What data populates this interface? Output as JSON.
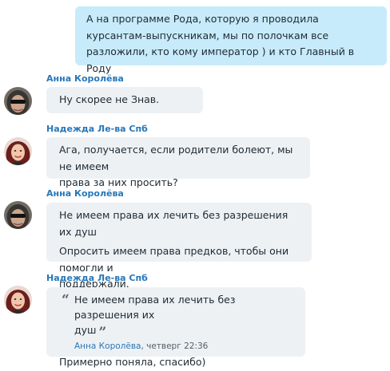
{
  "outgoing": {
    "lines": [
      "А на программе Рода, которую я проводила",
      "курсантам-выпускникам, мы по полочкам все",
      "разложили, кто кому император ) и кто Главный в Роду"
    ]
  },
  "messages": [
    {
      "sender": "Анна Королёва",
      "text_lines": [
        "Ну скорее не Знав."
      ]
    },
    {
      "sender": "Надежда Ле-ва Спб",
      "text_lines": [
        "Ага, получается, если родители болеют, мы не имеем",
        "права за них просить?"
      ]
    },
    {
      "sender": "Анна Королёва",
      "text_lines": [
        "Не имеем права их лечить без разрешения их душ"
      ],
      "text2_lines": [
        "Опросить имеем права предков, чтобы они помогли и",
        "поддержали."
      ]
    },
    {
      "sender": "Надежда Ле-ва Спб",
      "quote": {
        "lines": [
          "Не имеем права их лечить без разрешения их",
          "душ"
        ],
        "author": "Анна Королёва",
        "timestamp": ", четверг 22:36"
      },
      "text_lines": [
        "Примерно поняла, спасибо)"
      ]
    }
  ]
}
